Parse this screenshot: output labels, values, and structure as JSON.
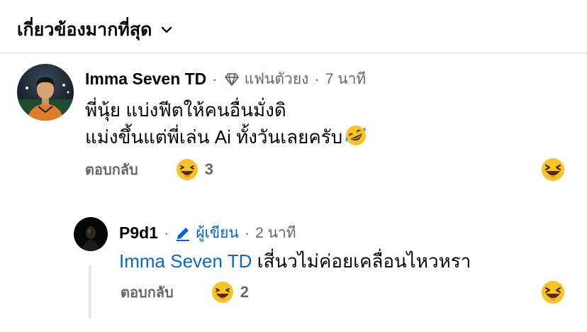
{
  "sort": {
    "label": "เกี่ยวข้องมากที่สุด"
  },
  "comments": [
    {
      "author": "Imma Seven TD",
      "badge": "แฟนตัวยง",
      "time": "7 นาที",
      "lines": [
        "พี่นุ้ย แบ่งฟีตให้คนอื่นมั่งดิ",
        "แม่งขึ้นแต่พี่เล่น Ai ทั้งวันเลยครับ"
      ],
      "reply_label": "ตอบกลับ",
      "reaction_count": "3"
    }
  ],
  "replies": [
    {
      "author": "P9d1",
      "badge": "ผู้เขียน",
      "time": "2 นาที",
      "mention": "Imma Seven TD",
      "text": "เสี่นวไม่ค่อยเคลื่อนไหวหรา",
      "reply_label": "ตอบกลับ",
      "reaction_count": "2"
    }
  ],
  "icons": {
    "sort_chevron": "chevron-down-icon",
    "fan_badge": "diamond-icon",
    "author_badge": "pencil-icon",
    "inline_emoji": "rofl-emoji-icon",
    "reaction": "haha-emoji-icon"
  },
  "colors": {
    "accent_blue": "#0064d1",
    "mention_blue": "#0a66d3",
    "muted_text": "#65676b"
  }
}
